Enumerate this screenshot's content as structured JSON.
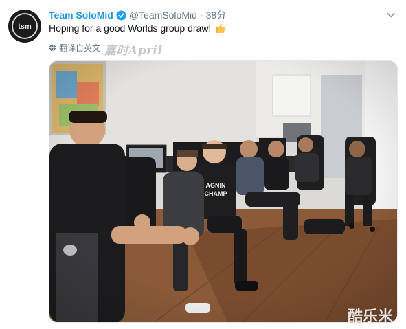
{
  "tweet": {
    "display_name": "Team SoloMid",
    "handle": "@TeamSoloMid",
    "separator": "·",
    "time": "38分",
    "text": "Hoping for a good Worlds group draw!",
    "translate_label": "翻译自英文",
    "emoji_icon": "thumbs-up-emoji",
    "verified_color": "#1da1f2",
    "name_color": "#1b95e0"
  },
  "photo": {
    "alt": "Team SoloMid players seated together in a gaming house room",
    "jersey_text": [
      "AGNIN",
      "CHAMP"
    ]
  },
  "watermarks": {
    "signature": "嘉时April",
    "corner": "酷乐米"
  }
}
